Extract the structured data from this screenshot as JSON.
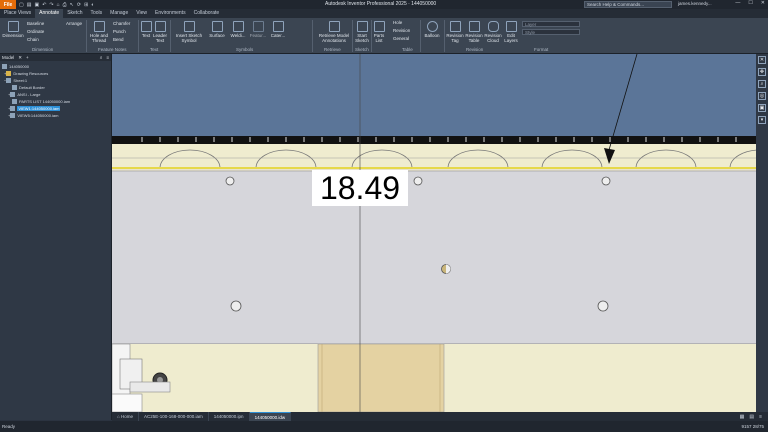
{
  "title": {
    "file_label": "File",
    "app_title": "Autodesk Inventor Professional 2025  · 144050000",
    "search_placeholder": "Search Help & Commands...",
    "user": "james.kennedy...",
    "window_buttons": [
      "—",
      "☐",
      "✕"
    ]
  },
  "tabs": [
    {
      "label": "Place Views",
      "active": false
    },
    {
      "label": "Annotate",
      "active": true
    },
    {
      "label": "Sketch",
      "active": false
    },
    {
      "label": "Tools",
      "active": false
    },
    {
      "label": "Manage",
      "active": false
    },
    {
      "label": "View",
      "active": false
    },
    {
      "label": "Environments",
      "active": false
    },
    {
      "label": "Collaborate",
      "active": false
    }
  ],
  "ribbon": {
    "dimension": "Dimension",
    "baseline": "Baseline",
    "arrange": "Arrange",
    "ordinate": "Ordinate",
    "chain": "Chain",
    "group_dimension": "Dimension",
    "hole_thread": "Hole and Thread",
    "chamfer": "Chamfer",
    "punch": "Punch",
    "bend": "Bend",
    "group_feature_notes": "Feature Notes",
    "text": "Text",
    "leader_text": "Leader Text",
    "group_text": "Text",
    "insert_sketch_symbol": "Insert Sketch Symbol",
    "surface": "Surface",
    "welding": "Weldi...",
    "feature": "Featur...",
    "caterpillar": "Cater...",
    "group_symbols": "Symbols",
    "retrieve_model": "Retrieve Model Annotations",
    "group_retrieve": "Retrieve",
    "start_sketch": "Start Sketch",
    "group_sketch": "Sketch",
    "parts_list": "Parts List",
    "hole": "Hole",
    "revision": "Revision",
    "general": "General",
    "group_table": "Table",
    "balloon": "Balloon",
    "revision_tag": "Revision Tag",
    "revision_table": "Revision Table",
    "revision_cloud": "Revision Cloud",
    "edit_layers": "Edit Layers",
    "group_revision": "Revision",
    "layer": "Layer",
    "style": "Style",
    "group_format": "Format"
  },
  "browser": {
    "tab": "Model",
    "tree": [
      {
        "label": "144050000",
        "level": 0,
        "selected": false
      },
      {
        "label": "Drawing Resources",
        "level": 1,
        "selected": false
      },
      {
        "label": "Sheet:1",
        "level": 1,
        "selected": false
      },
      {
        "label": "Default Border",
        "level": 2,
        "selected": false
      },
      {
        "label": "ANSI - Large",
        "level": 2,
        "selected": false
      },
      {
        "label": "PARTS LIST 144050000.iam",
        "level": 2,
        "selected": false
      },
      {
        "label": "VIEW1:144050000.iam",
        "level": 2,
        "selected": true
      },
      {
        "label": "VIEW5:144050000.iam",
        "level": 2,
        "selected": false
      }
    ]
  },
  "dimension_value": "18.49",
  "doc_tabs": [
    {
      "label": "Home",
      "active": false
    },
    {
      "label": "AC25E-100-168-000-000.iam",
      "active": false
    },
    {
      "label": "144050000.ipn",
      "active": false
    },
    {
      "label": "144050000.idw",
      "active": true
    }
  ],
  "status": {
    "left": "Ready",
    "right": "9157    28/75"
  },
  "colors": {
    "file_button": "#e46c0a",
    "selection": "#2c8fd6",
    "sheet_blue": "#5b7598",
    "part_grey": "#d6d6db"
  }
}
